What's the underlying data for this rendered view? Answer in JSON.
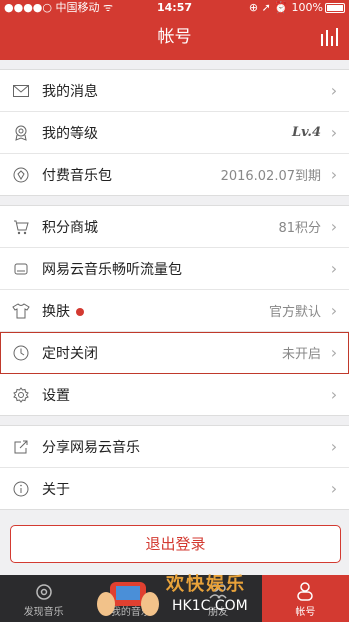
{
  "status_bar": {
    "carrier": "●●●●○ 中国移动 ᯤ",
    "time": "14:57",
    "right": "⊕ ➚ ⏰ 100%"
  },
  "header": {
    "title": "帐号"
  },
  "section1": [
    {
      "label": "我的消息",
      "value": "",
      "icon": "envelope-icon"
    },
    {
      "label": "我的等级",
      "value": "Lv.4",
      "icon": "medal-icon"
    },
    {
      "label": "付费音乐包",
      "value": "2016.02.07到期",
      "icon": "diamond-icon"
    }
  ],
  "section2": [
    {
      "label": "积分商城",
      "value": "81积分",
      "icon": "cart-icon"
    },
    {
      "label": "网易云音乐畅听流量包",
      "value": "",
      "icon": "sim-icon"
    },
    {
      "label": "换肤",
      "value": "官方默认",
      "icon": "tshirt-icon"
    },
    {
      "label": "定时关闭",
      "value": "未开启",
      "icon": "clock-icon"
    },
    {
      "label": "设置",
      "value": "",
      "icon": "gear-icon"
    }
  ],
  "section3": [
    {
      "label": "分享网易云音乐",
      "value": "",
      "icon": "share-icon"
    },
    {
      "label": "关于",
      "value": "",
      "icon": "info-icon"
    }
  ],
  "logout_label": "退出登录",
  "tabs": [
    {
      "label": "发现音乐",
      "icon": "netease-logo-icon"
    },
    {
      "label": "我的音乐",
      "icon": "music-icon"
    },
    {
      "label": "朋友",
      "icon": "friends-icon"
    },
    {
      "label": "帐号",
      "icon": "user-icon"
    }
  ],
  "watermark": {
    "title": "欢快娱乐",
    "sub": "HK1C.COM"
  },
  "colors": {
    "brand": "#d33a31",
    "tabbar": "#2b2b2d"
  }
}
